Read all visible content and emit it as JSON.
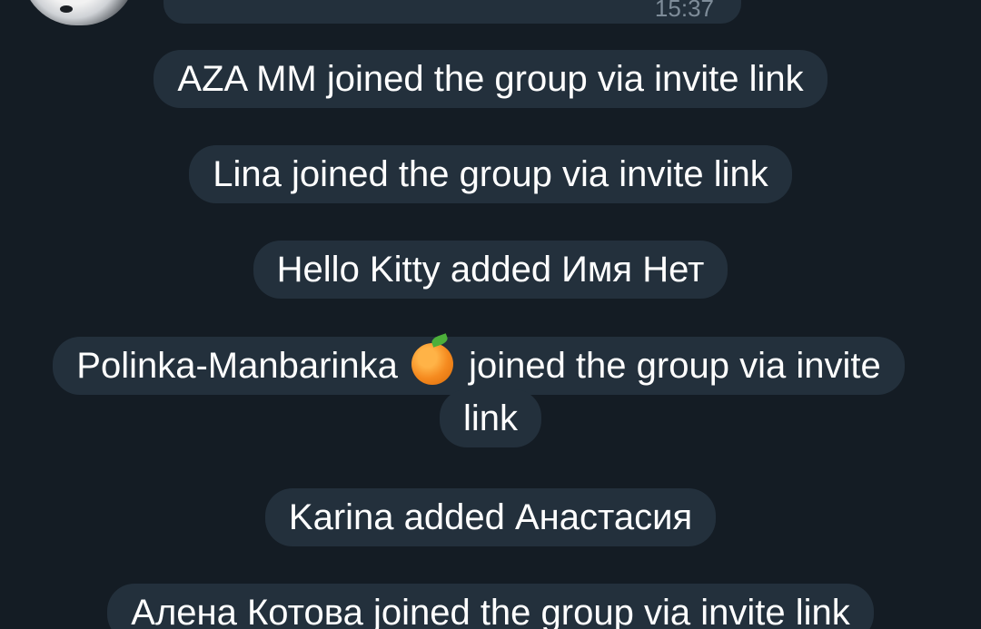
{
  "previous_message": {
    "time": "15:37"
  },
  "service_messages": [
    {
      "text": "AZA MM joined the group via invite link"
    },
    {
      "text": "Lina joined the group via invite link"
    },
    {
      "text": "Hello Kitty added Имя Нет"
    },
    {
      "text_before_emoji": "Polinka-Manbarinka",
      "emoji": "orange-emoji",
      "text_after_emoji": "joined the group via invite link"
    },
    {
      "text": "Karina added Анастасия"
    },
    {
      "text": "Алена Котова joined the group via invite link"
    }
  ],
  "colors": {
    "background": "#141c24",
    "bubble": "#23303c",
    "text": "#ffffff",
    "time": "#7e8c99"
  }
}
